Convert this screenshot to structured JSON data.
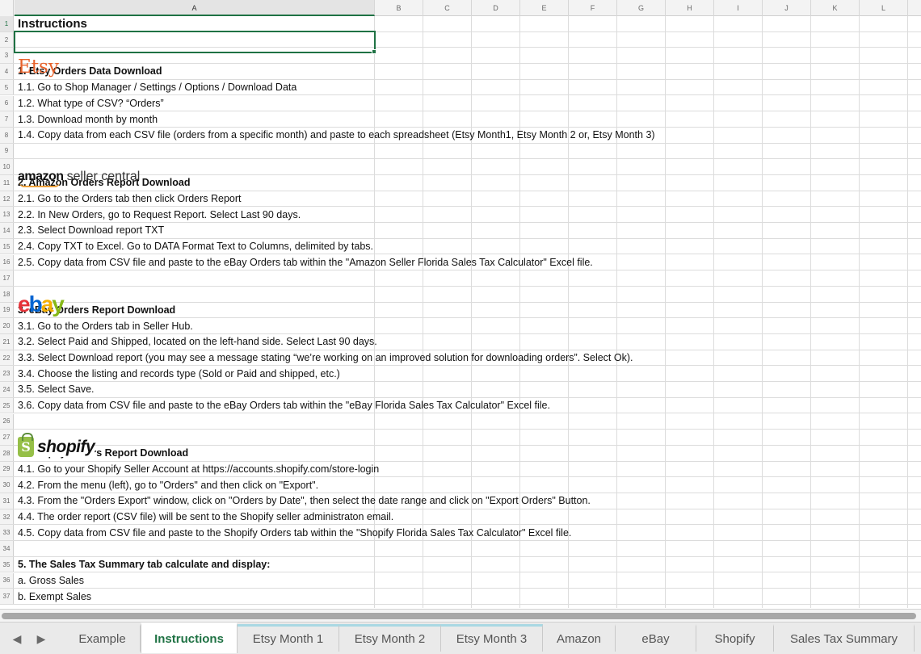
{
  "columns": [
    "A",
    "B",
    "C",
    "D",
    "E",
    "F",
    "G",
    "H",
    "I",
    "J",
    "K",
    "L"
  ],
  "rows": [
    {
      "num": "1",
      "text": "Instructions",
      "style": "title"
    },
    {
      "num": "2",
      "text": ""
    },
    {
      "num": "3",
      "text": ""
    },
    {
      "num": "4",
      "text": "1. Etsy Orders Data Download",
      "style": "bold"
    },
    {
      "num": "5",
      "text": "1.1. Go to Shop Manager / Settings / Options / Download Data"
    },
    {
      "num": "6",
      "text": "1.2. What type of CSV?  “Orders”"
    },
    {
      "num": "7",
      "text": "1.3. Download month by month"
    },
    {
      "num": "8",
      "text": "1.4. Copy data from each CSV file (orders from a specific month) and paste to each spreadsheet (Etsy Month1, Etsy Month 2 or, Etsy Month 3)"
    },
    {
      "num": "9",
      "text": ""
    },
    {
      "num": "10",
      "text": ""
    },
    {
      "num": "11",
      "text": "2. Amazon Orders Report Download",
      "style": "bold"
    },
    {
      "num": "12",
      "text": "2.1. Go to the Orders tab then click Orders Report"
    },
    {
      "num": "13",
      "text": "2.2. In New Orders, go to Request Report. Select Last 90 days."
    },
    {
      "num": "14",
      "text": "2.3. Select Download report TXT"
    },
    {
      "num": "15",
      "text": "2.4. Copy TXT to Excel. Go to DATA Format Text to Columns, delimited by tabs."
    },
    {
      "num": "16",
      "text": "2.5. Copy data from CSV file and paste to the eBay Orders tab within the \"Amazon Seller Florida Sales Tax Calculator\" Excel file."
    },
    {
      "num": "17",
      "text": ""
    },
    {
      "num": "18",
      "text": ""
    },
    {
      "num": "19",
      "text": "3. eBay Orders Report Download",
      "style": "bold"
    },
    {
      "num": "20",
      "text": "3.1. Go to the Orders tab in Seller Hub."
    },
    {
      "num": "21",
      "text": "3.2. Select Paid and Shipped, located on the left-hand side. Select Last 90 days."
    },
    {
      "num": "22",
      "text": "3.3. Select Download report (you may see a message stating “we’re working on an improved solution for downloading orders”. Select Ok)."
    },
    {
      "num": "23",
      "text": "3.4. Choose the listing and records type (Sold or Paid and shipped, etc.)"
    },
    {
      "num": "24",
      "text": "3.5. Select Save."
    },
    {
      "num": "25",
      "text": "3.6. Copy data from CSV file and paste to the eBay Orders tab within the \"eBay  Florida Sales Tax Calculator\" Excel file."
    },
    {
      "num": "26",
      "text": ""
    },
    {
      "num": "27",
      "text": ""
    },
    {
      "num": "28",
      "text": "4. Shopify Orders Report Download",
      "style": "bold"
    },
    {
      "num": "29",
      "text": "4.1. Go to your Shopify Seller Account at https://accounts.shopify.com/store-login"
    },
    {
      "num": "30",
      "text": "4.2. From the menu (left), go to \"Orders\" and then click on \"Export\"."
    },
    {
      "num": "31",
      "text": "4.3. From the \"Orders Export\" window, click on \"Orders by Date\", then select the date range and click on \"Export Orders\" Button."
    },
    {
      "num": "32",
      "text": "4.4. The order report (CSV file) will be sent to the Shopify seller administraton email."
    },
    {
      "num": "33",
      "text": "4.5. Copy data from CSV file and paste to the Shopify Orders tab within the \"Shopify  Florida Sales Tax Calculator\" Excel file."
    },
    {
      "num": "34",
      "text": ""
    },
    {
      "num": "35",
      "text": "5. The Sales Tax Summary tab calculate and display:",
      "style": "bold"
    },
    {
      "num": "36",
      "text": "a. Gross Sales"
    },
    {
      "num": "37",
      "text": "b. Exempt Sales"
    }
  ],
  "logos": {
    "etsy": "Etsy",
    "amazon_brand": "amazon",
    "amazon_suffix": "seller central",
    "ebay": [
      "e",
      "b",
      "a",
      "y"
    ],
    "shopify_mark": "S",
    "shopify": "shopify"
  },
  "tabs": [
    {
      "label": "Example",
      "active": false,
      "teal": false
    },
    {
      "label": "Instructions",
      "active": true,
      "teal": false
    },
    {
      "label": "Etsy Month 1",
      "active": false,
      "teal": true
    },
    {
      "label": "Etsy Month 2",
      "active": false,
      "teal": true
    },
    {
      "label": "Etsy Month 3",
      "active": false,
      "teal": true
    },
    {
      "label": "Amazon",
      "active": false,
      "teal": false
    },
    {
      "label": "eBay",
      "active": false,
      "teal": false
    },
    {
      "label": "Shopify",
      "active": false,
      "teal": false
    },
    {
      "label": "Sales Tax Summary",
      "active": false,
      "teal": false
    }
  ],
  "nav": {
    "prev": "◀",
    "next": "▶"
  },
  "colors": {
    "accent": "#1f7244",
    "etsy": "#e8622b",
    "shopify_green": "#95bf47"
  }
}
